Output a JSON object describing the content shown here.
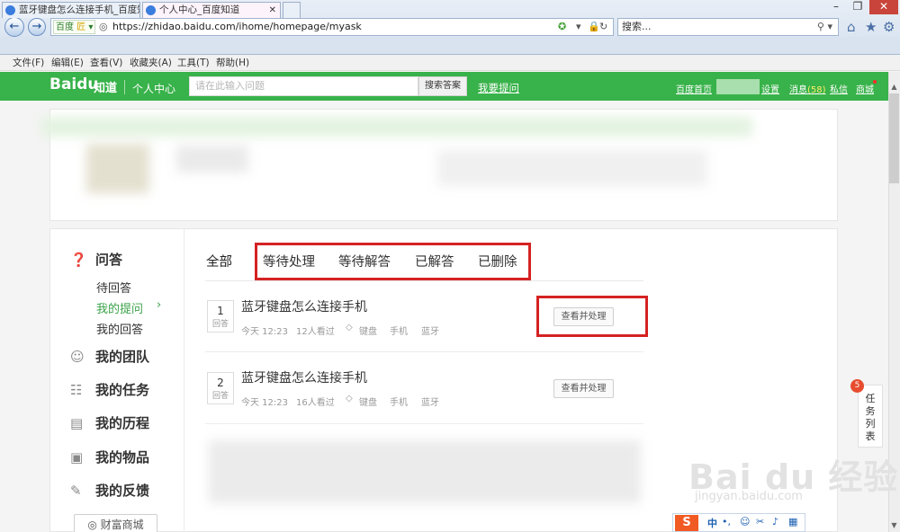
{
  "browser": {
    "window_buttons": [
      "–",
      "❐",
      "✕"
    ],
    "nav": {
      "back": "←",
      "forward": "→"
    },
    "address": {
      "brand": "百度",
      "brand_mark": "匠",
      "url": "https://zhidao.baidu.com/ihome/homepage/myask"
    },
    "search": {
      "placeholder": "搜索..."
    },
    "tabs": [
      {
        "label": "蓝牙键盘怎么连接手机_百度知..."
      },
      {
        "label": "个人中心_百度知道",
        "close": "✕"
      }
    ],
    "menu": [
      "文件(F)",
      "编辑(E)",
      "查看(V)",
      "收藏夹(A)",
      "工具(T)",
      "帮助(H)"
    ]
  },
  "header": {
    "logo_text": "Baidu",
    "logo_zh": "知道",
    "center_label": "个人中心",
    "search_placeholder": "请在此输入问题",
    "search_button": "搜索答案",
    "ask_link": "我要提问",
    "links": {
      "home": "百度首页",
      "settings": "设置",
      "messages_label": "消息",
      "messages_count": "(58)",
      "private": "私信",
      "mall": "商城"
    }
  },
  "sidebar": {
    "qa_title": "问答",
    "qa_subitems": [
      "待回答",
      "我的提问",
      "我的回答"
    ],
    "sections": [
      {
        "label": "我的团队",
        "icon": "team-icon"
      },
      {
        "label": "我的任务",
        "icon": "task-icon"
      },
      {
        "label": "我的历程",
        "icon": "calendar-icon"
      },
      {
        "label": "我的物品",
        "icon": "box-icon"
      },
      {
        "label": "我的反馈",
        "icon": "edit-icon"
      }
    ],
    "mall_button": "财富商城"
  },
  "main": {
    "tabs": [
      "全部",
      "等待处理",
      "等待解答",
      "已解答",
      "已删除"
    ],
    "questions": [
      {
        "count": "1",
        "count_label": "回答",
        "title": "蓝牙键盘怎么连接手机",
        "time": "今天 12:23",
        "views": "12人看过",
        "tags": [
          "键盘",
          "手机",
          "蓝牙"
        ],
        "action": "查看并处理"
      },
      {
        "count": "2",
        "count_label": "回答",
        "title": "蓝牙键盘怎么连接手机",
        "time": "今天 12:23",
        "views": "16人看过",
        "tags": [
          "键盘",
          "手机",
          "蓝牙"
        ],
        "action": "查看并处理"
      }
    ]
  },
  "task_panel": {
    "badge": "5",
    "label": "任务列表"
  },
  "watermark": {
    "text": "Bai du 经验",
    "url": "jingyan.baidu.com"
  },
  "ime": {
    "logo": "S",
    "mode": "中"
  },
  "colors": {
    "brand_green": "#38b24a",
    "highlight_red": "#d52222",
    "active_green": "#3aa34a"
  }
}
